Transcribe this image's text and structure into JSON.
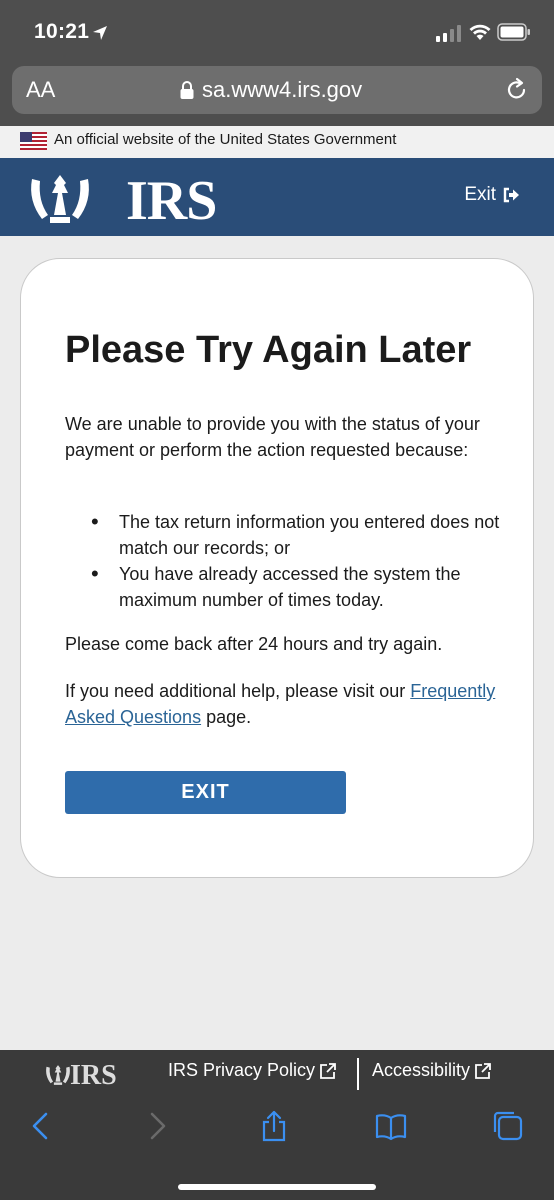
{
  "status_bar": {
    "time": "10:21"
  },
  "browser": {
    "aa_label": "AA",
    "url": "sa.www4.irs.gov"
  },
  "gov_banner": {
    "text": "An official website of the United States Government"
  },
  "header": {
    "logo_text": "IRS",
    "exit_label": "Exit"
  },
  "card": {
    "title": "Please Try Again Later",
    "intro": "We are unable to provide you with the status of your payment or perform the action requested because:",
    "reasons": [
      "The tax return information you entered does not match our records; or",
      "You have already accessed the system the maximum number of times today."
    ],
    "come_back": "Please come back after 24 hours and try again.",
    "help_prefix": "If you need additional help, please visit our ",
    "faq_link": "Frequently Asked Questions",
    "help_suffix": " page.",
    "exit_button": "EXIT"
  },
  "footer": {
    "logo_text": "IRS",
    "privacy_link": "IRS Privacy Policy",
    "accessibility_link": "Accessibility"
  },
  "colors": {
    "header_blue": "#2a4d78",
    "button_blue": "#2f6cab",
    "link_blue": "#2a6496",
    "ios_blue": "#3b8ff0"
  }
}
